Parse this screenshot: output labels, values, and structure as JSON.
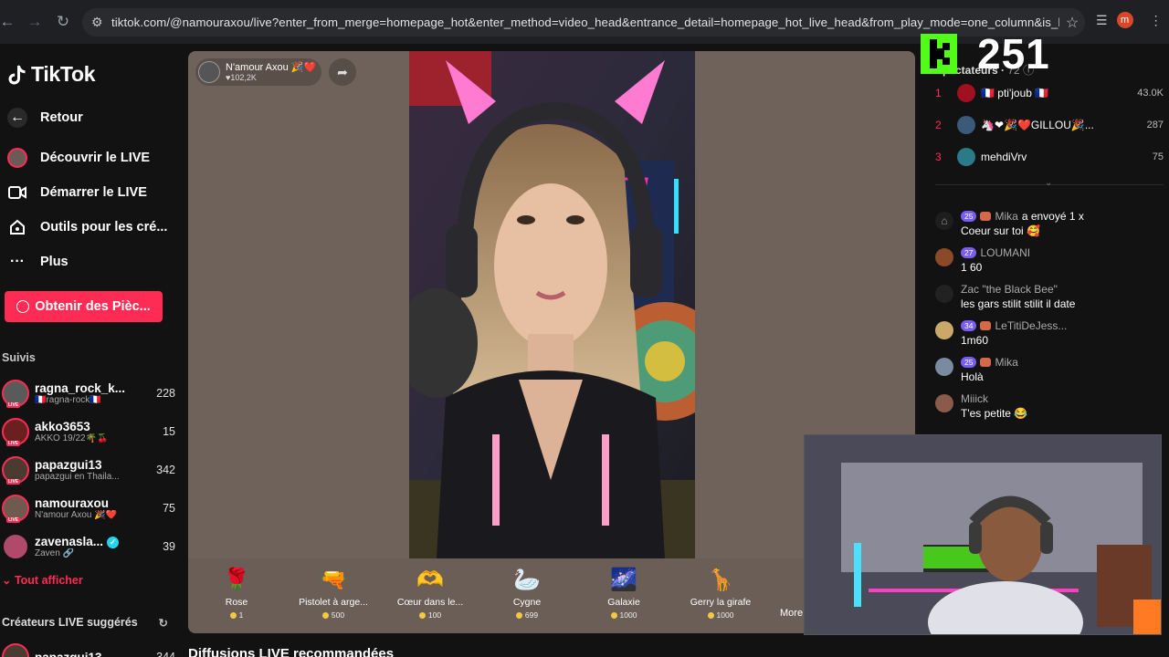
{
  "browser": {
    "url": "tiktok.com/@namouraxou/live?enter_from_merge=homepage_hot&enter_method=video_head&entrance_detail=homepage_hot_live_head&from_play_mode=one_column&is_hig...",
    "profile_initial": "m"
  },
  "sidebar": {
    "logo": "TikTok",
    "back": "Retour",
    "nav": [
      {
        "label": "Découvrir le LIVE"
      },
      {
        "label": "Démarrer le LIVE"
      },
      {
        "label": "Outils pour les cré..."
      },
      {
        "label": "Plus"
      }
    ],
    "coins_button": "Obtenir des Pièc...",
    "following_label": "Suivis",
    "following": [
      {
        "name": "ragna_rock_k...",
        "sub": "🇫🇷ragna-rock🇫🇷",
        "count": "228"
      },
      {
        "name": "akko3653",
        "sub": "AKKO 19/22🌴🍒",
        "count": "15"
      },
      {
        "name": "papazgui13",
        "sub": "papazgui en Thaila...",
        "count": "342"
      },
      {
        "name": "namouraxou",
        "sub": "N'amour Axou 🎉❤️",
        "count": "75"
      },
      {
        "name": "zavenasla...",
        "sub": "Zaven 🔗",
        "count": "39"
      }
    ],
    "show_all": "Tout afficher",
    "suggested_label": "Créateurs LIVE suggérés",
    "suggested_first": "papazgui13",
    "suggested_first_count": "344"
  },
  "player": {
    "host_name": "N'amour Axou 🎉❤️",
    "host_likes": "102,2K",
    "gifts": [
      {
        "name": "Rose",
        "price": "1",
        "icon": "rose-icon"
      },
      {
        "name": "Pistolet à arge...",
        "price": "500",
        "icon": "money-gun-icon"
      },
      {
        "name": "Cœur dans le...",
        "price": "100",
        "icon": "heart-hands-icon"
      },
      {
        "name": "Cygne",
        "price": "699",
        "icon": "swan-icon"
      },
      {
        "name": "Galaxie",
        "price": "1000",
        "icon": "galaxy-icon"
      },
      {
        "name": "Gerry la girafe",
        "price": "1000",
        "icon": "giraffe-icon"
      }
    ],
    "more": "More"
  },
  "recommended_title": "Diffusions LIVE recommandées",
  "overlay": {
    "kick_viewers": "251"
  },
  "viewers": {
    "label": "Spectateurs",
    "count": "72",
    "top": [
      {
        "rank": "1",
        "name": "🇫🇷 pti'joub 🇫🇷",
        "value": "43.0K"
      },
      {
        "rank": "2",
        "name": "🦄❤🎉❤️GILLOU🎉...",
        "value": "287"
      },
      {
        "rank": "3",
        "name": "mehdiVrv",
        "value": "75"
      }
    ]
  },
  "chat": [
    {
      "badge": "25",
      "user": "Mika",
      "text_inline": "a envoyé 1 x",
      "text": "Coeur sur toi 🥰"
    },
    {
      "badge": "27",
      "user": "LOUMANI",
      "text": "1 60"
    },
    {
      "badge": "",
      "user": "Zac \"the Black Bee\"",
      "text": "les gars stilit stilit il date"
    },
    {
      "badge": "34",
      "user": "LeTitiDeJess...",
      "text": "1m60"
    },
    {
      "badge": "25",
      "user": "Mika",
      "text": "Holà"
    },
    {
      "badge": "",
      "user": "Miiick",
      "text": "T'es petite 😂"
    }
  ]
}
